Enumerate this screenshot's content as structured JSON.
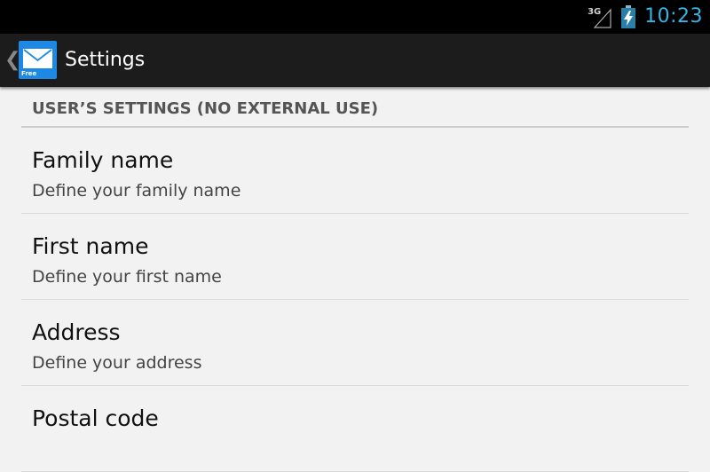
{
  "status_bar": {
    "network": "3G",
    "time": "10:23",
    "icons": [
      "signal-icon",
      "battery-charging-icon"
    ],
    "clock_color": "#33b5e5"
  },
  "action_bar": {
    "up_icon": "chevron-left-icon",
    "app_icon": "mail-envelope-icon",
    "app_icon_badge": "Free",
    "title": "Settings",
    "accent": "#1e88e5"
  },
  "settings": {
    "category": "USER’S SETTINGS (NO EXTERNAL USE)",
    "items": [
      {
        "title": "Family name",
        "summary": "Define your family name"
      },
      {
        "title": "First name",
        "summary": "Define your first name"
      },
      {
        "title": "Address",
        "summary": "Define your address"
      },
      {
        "title": "Postal code",
        "summary": ""
      }
    ]
  }
}
